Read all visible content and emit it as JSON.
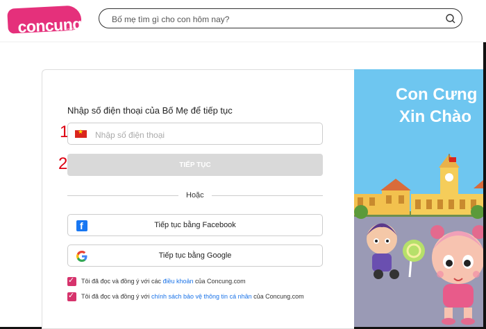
{
  "header": {
    "logo_text": "concung",
    "logo_sub": ".com",
    "search_placeholder": "Bố mẹ tìm gì cho con hôm nay?"
  },
  "login": {
    "intro": "Nhập số điện thoại của Bố Mẹ để tiếp tục",
    "marker_1": "1",
    "marker_2": "2",
    "phone_placeholder": "Nhập số điện thoại",
    "continue_label": "TIẾP TỤC",
    "or_label": "Hoặc",
    "facebook_label": "Tiếp tục bằng Facebook",
    "google_label": "Tiếp tục bằng Google",
    "agree1_prefix": "Tôi đã đọc và đồng ý với các",
    "agree1_link": "điều khoản",
    "agree1_suffix": "của Concung.com",
    "agree2_prefix": "Tôi đã đọc và đồng ý với",
    "agree2_link": "chính sách bảo vệ thông tin cá nhân",
    "agree2_suffix": "của Concung.com"
  },
  "banner": {
    "line1": "Con Cưng",
    "line2": "Xin Chào"
  },
  "colors": {
    "brand": "#e5307b",
    "banner_sky": "#6ec6f0",
    "link": "#1a73e8",
    "checkbox": "#d6336c"
  }
}
